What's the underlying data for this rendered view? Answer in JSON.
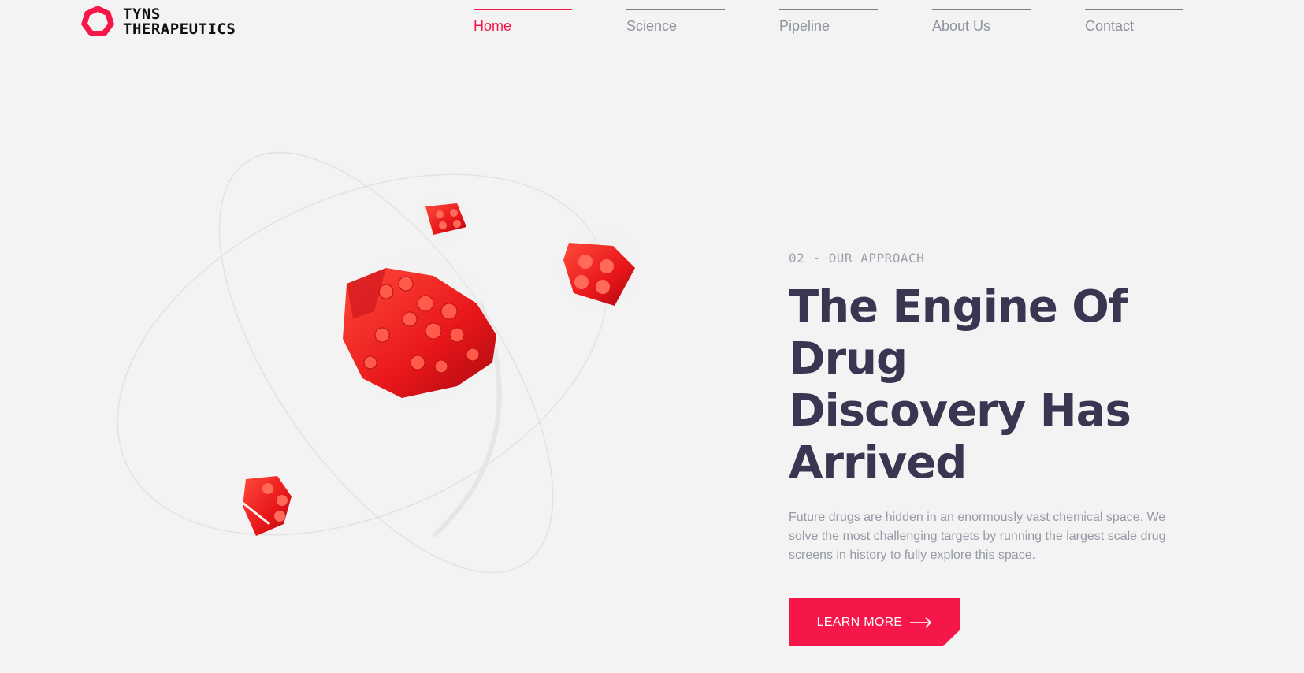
{
  "brand": {
    "name_line1": "TYNS",
    "name_line2": "THERAPEUTICS",
    "accent_color": "#f5174a"
  },
  "nav": {
    "items": [
      {
        "label": "Home",
        "active": true
      },
      {
        "label": "Science",
        "active": false
      },
      {
        "label": "Pipeline",
        "active": false
      },
      {
        "label": "About Us",
        "active": false
      },
      {
        "label": "Contact",
        "active": false
      }
    ]
  },
  "hero": {
    "eyebrow": "02 - OUR APPROACH",
    "headline": "The Engine Of Drug Discovery Has Arrived",
    "description": "Future drugs are hidden in an enormously vast chemical space. We solve the most challenging targets by running the largest scale drug screens in history to fully explore this space.",
    "cta_label": "LEARN MORE",
    "cta_icon": "arrow-right-icon",
    "illustration": "orbiting-red-bricks-illustration"
  },
  "colors": {
    "background": "#f3f3f3",
    "headline": "#383650",
    "muted_text": "#969aa6"
  }
}
